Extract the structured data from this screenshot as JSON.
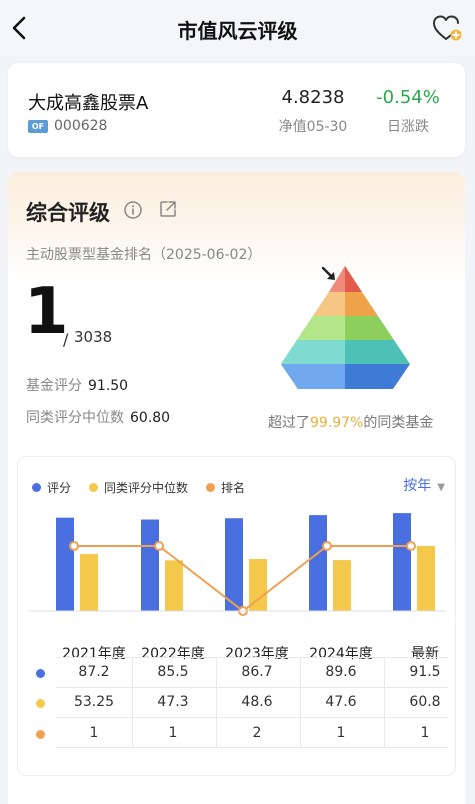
{
  "header": {
    "title": "市值风云评级",
    "back_icon": "back-arrow-icon",
    "fav_icon": "heart-plus-icon"
  },
  "fund": {
    "name": "大成高鑫股票A",
    "type_tag": "OF",
    "code": "000628",
    "nav_value": "4.8238",
    "nav_label": "净值05-30",
    "change_value": "-0.54%",
    "change_label": "日涨跌"
  },
  "rating": {
    "title": "综合评级",
    "caption": "主动股票型基金排名（2025-06-02）",
    "rank": "1",
    "separator": "/",
    "total": "3038",
    "score_label": "基金评分",
    "score_value": "91.50",
    "median_label": "同类评分中位数",
    "median_value": "60.80",
    "exceed_prefix": "超过了",
    "exceed_value": "99.97%",
    "exceed_suffix": "的同类基金"
  },
  "chart_panel": {
    "legend": [
      "评分",
      "同类评分中位数",
      "排名"
    ],
    "period_label": "按年",
    "columns": [
      "2021年度",
      "2022年度",
      "2023年度",
      "2024年度",
      "最新"
    ],
    "rows": [
      {
        "values": [
          "87.2",
          "85.5",
          "86.7",
          "89.6",
          "91.5"
        ]
      },
      {
        "values": [
          "53.25",
          "47.3",
          "48.6",
          "47.6",
          "60.8"
        ]
      },
      {
        "values": [
          "1",
          "1",
          "2",
          "1",
          "1"
        ]
      }
    ]
  },
  "chart_data": {
    "type": "bar",
    "categories": [
      "2021年度",
      "2022年度",
      "2023年度",
      "2024年度",
      "最新"
    ],
    "series": [
      {
        "name": "评分",
        "kind": "bar",
        "color": "#4a6fe0",
        "values": [
          87.2,
          85.5,
          86.7,
          89.6,
          91.5
        ]
      },
      {
        "name": "同类评分中位数",
        "kind": "bar",
        "color": "#f4c84a",
        "values": [
          53.25,
          47.3,
          48.6,
          47.6,
          60.8
        ]
      },
      {
        "name": "排名",
        "kind": "line",
        "color": "#f0a050",
        "values": [
          1,
          1,
          2,
          1,
          1
        ]
      }
    ],
    "legend_position": "top-left",
    "grid": false
  },
  "colors": {
    "score": "#4a6fe0",
    "median": "#f4c84a",
    "rank": "#f0a050",
    "negative": "#2aa84a",
    "highlight": "#e8b23a"
  }
}
